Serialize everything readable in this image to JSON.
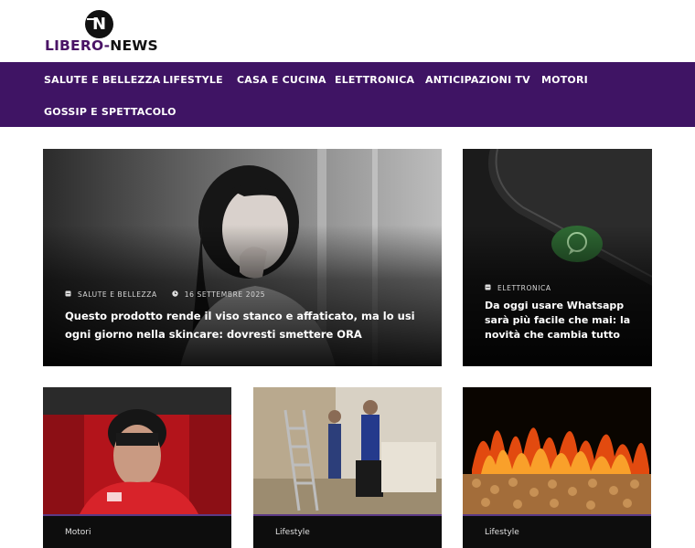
{
  "logo": {
    "icon_letter": "N",
    "text_part1": "LIBERO-",
    "text_part2": "NEWS"
  },
  "nav": {
    "items": [
      {
        "label": "SALUTE E BELLEZZA"
      },
      {
        "label": "LIFESTYLE"
      },
      {
        "label": "CASA E CUCINA"
      },
      {
        "label": "ELETTRONICA"
      },
      {
        "label": "ANTICIPAZIONI TV"
      },
      {
        "label": "MOTORI"
      },
      {
        "label": "GOSSIP E SPETTACOLO"
      }
    ]
  },
  "featured": {
    "category": "SALUTE E BELLEZZA",
    "date": "16 SETTEMBRE 2025",
    "title": "Questo prodotto rende il viso stanco e affaticato, ma lo usi ogni giorno nella skincare: dovresti smettere ORA",
    "category_icon": "folder-icon",
    "date_icon": "clock-icon"
  },
  "side": {
    "category": "ELETTRONICA",
    "title": "Da oggi usare Whatsapp sarà più facile che mai: la novità che cambia tutto",
    "category_icon": "folder-icon"
  },
  "bottom_cards": [
    {
      "category": "Motori"
    },
    {
      "category": "Lifestyle"
    },
    {
      "category": "Lifestyle"
    }
  ],
  "colors": {
    "brand_purple": "#3f1464",
    "accent_rule": "#5c3a86"
  }
}
